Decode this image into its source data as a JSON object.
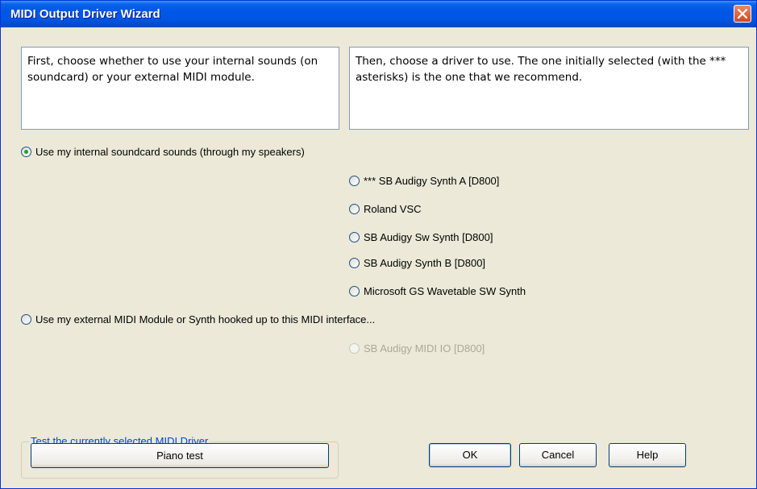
{
  "window": {
    "title": "MIDI Output Driver Wizard"
  },
  "instructions": {
    "left": "First, choose whether to use your internal sounds (on soundcard) or your external MIDI module.",
    "right": "Then, choose a driver to use. The one initially selected (with the *** asterisks) is the one that we recommend."
  },
  "internal_option": {
    "label": "Use my internal soundcard sounds (through my speakers)",
    "checked": true
  },
  "internal_drivers": [
    {
      "label": "*** SB Audigy Synth A [D800]",
      "checked": false
    },
    {
      "label": "Roland VSC",
      "checked": false
    },
    {
      "label": "SB Audigy Sw Synth [D800]",
      "checked": false
    },
    {
      "label": "SB Audigy Synth B [D800]",
      "checked": false
    },
    {
      "label": "Microsoft GS Wavetable SW Synth",
      "checked": false
    }
  ],
  "external_option": {
    "label": "Use my external MIDI Module or Synth hooked up to this MIDI interface...",
    "checked": false
  },
  "external_drivers": [
    {
      "label": "SB Audigy MIDI IO [D800]",
      "enabled": false
    }
  ],
  "test_group": {
    "label": "Test the currently selected MIDI Driver",
    "piano_test": "Piano test"
  },
  "buttons": {
    "ok": "OK",
    "cancel": "Cancel",
    "help": "Help"
  },
  "colors": {
    "titlebar": "#0055e5",
    "dialog_bg": "#ece9d8",
    "radio_dot": "#21a121",
    "group_label": "#0046d5"
  }
}
